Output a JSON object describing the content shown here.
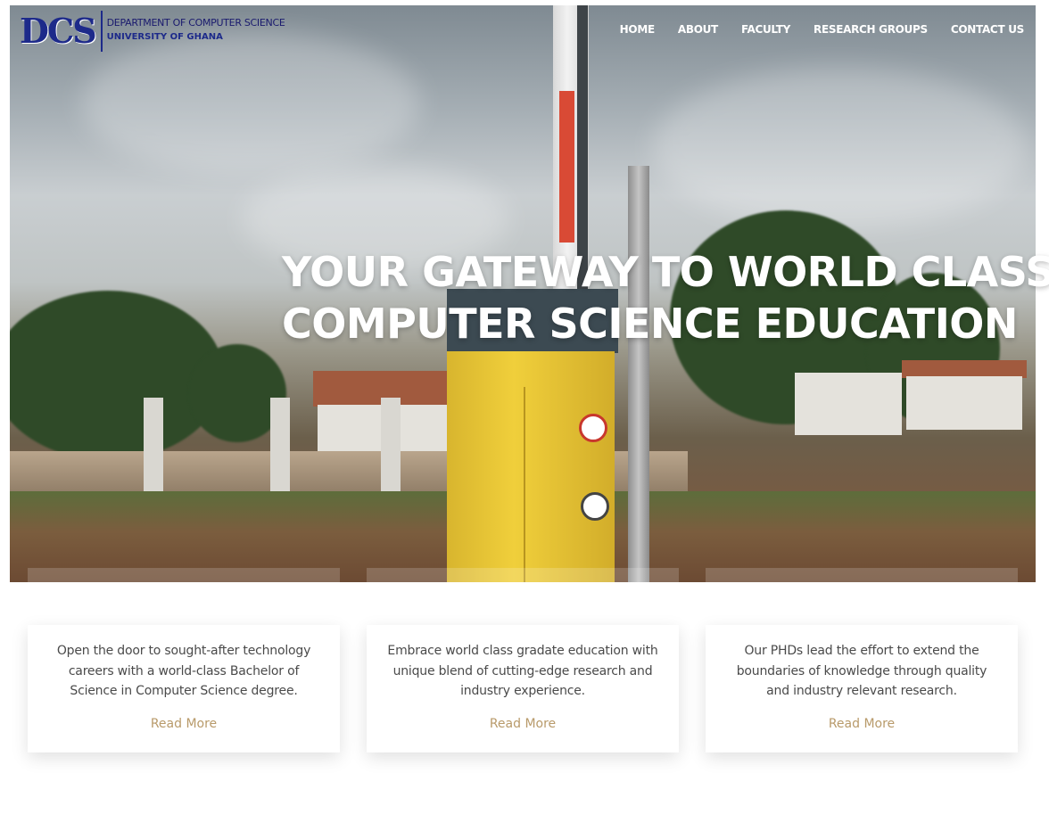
{
  "logo": {
    "mark": "DCS",
    "line1": "DEPARTMENT OF COMPUTER SCIENCE",
    "line2": "UNIVERSITY OF GHANA"
  },
  "nav": {
    "items": [
      {
        "label": "HOME"
      },
      {
        "label": "ABOUT"
      },
      {
        "label": "FACULTY"
      },
      {
        "label": "RESEARCH GROUPS"
      },
      {
        "label": "CONTACT US"
      }
    ]
  },
  "hero": {
    "headline_line1": "YOUR GATEWAY TO WORLD CLASS",
    "headline_line2": "COMPUTER SCIENCE EDUCATION"
  },
  "cards": [
    {
      "text": "Open the door to sought-after technology careers with a world-class Bachelor of Science in Computer Science degree.",
      "link": "Read More"
    },
    {
      "text": "Embrace world class gradate education with unique blend of cutting-edge research and industry experience.",
      "link": "Read More"
    },
    {
      "text": "Our PHDs lead the effort to extend the boundaries of knowledge through quality and industry relevant research.",
      "link": "Read More"
    }
  ],
  "colors": {
    "brand_navy": "#1d2a8a",
    "link_gold": "#b89a6a",
    "nav_text": "#ffffff"
  }
}
